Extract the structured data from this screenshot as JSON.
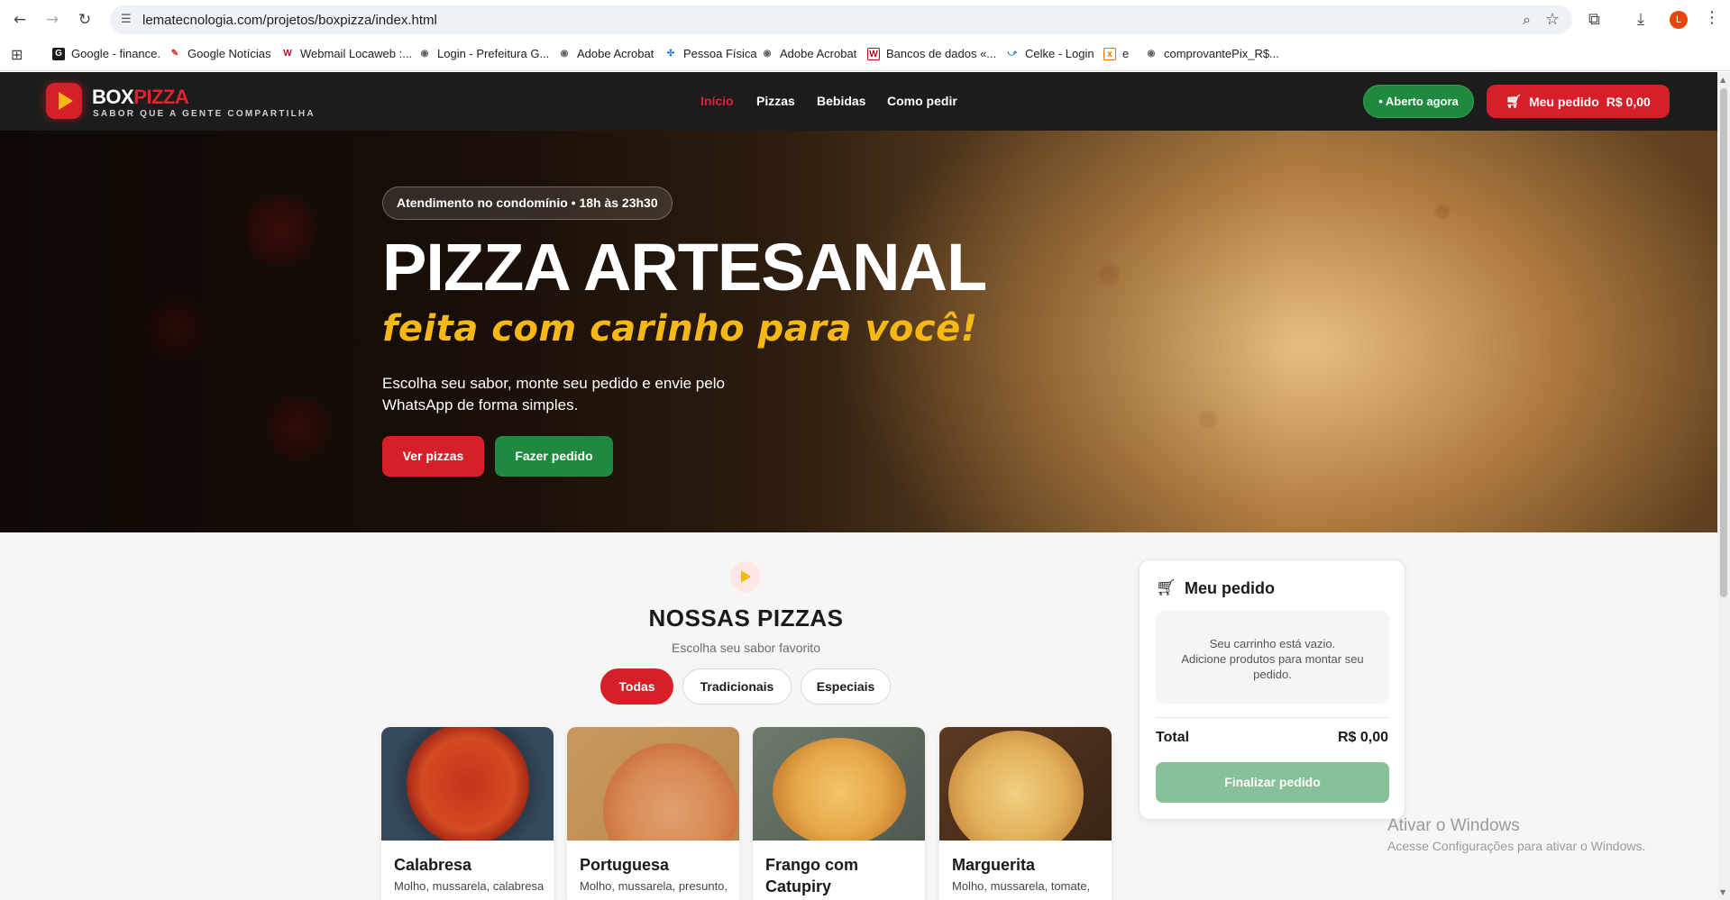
{
  "browser": {
    "url": "lematecnologia.com/projetos/boxpizza/index.html",
    "profile_initial": "L",
    "icons": {
      "back": "back-arrow-icon",
      "forward": "forward-arrow-icon",
      "reload": "reload-icon",
      "site_info": "site-info-icon",
      "zoom": "zoom-icon",
      "bookmark": "star-icon",
      "extensions": "puzzle-icon",
      "downloads": "download-icon",
      "menu": "kebab-menu-icon"
    }
  },
  "bookmarks": [
    {
      "label": "Google - finance.",
      "fav_color": "#1a1a1a"
    },
    {
      "label": "Google Notícias",
      "fav_color": "#d93025"
    },
    {
      "label": "Webmail Locaweb :...",
      "fav_color": "#c4001d"
    },
    {
      "label": "Login - Prefeitura G...",
      "fav_color": "#5f6368"
    },
    {
      "label": "Adobe Acrobat",
      "fav_color": "#5f6368"
    },
    {
      "label": "Pessoa Física",
      "fav_color": "#1a73e8"
    },
    {
      "label": "Adobe Acrobat",
      "fav_color": "#5f6368"
    },
    {
      "label": "Bancos de dados «...",
      "fav_color": "#c4001d"
    },
    {
      "label": "Celke - Login",
      "fav_color": "#1a73e8"
    },
    {
      "label": "e",
      "fav_color": "#e8710a"
    },
    {
      "label": "comprovantePix_R$...",
      "fav_color": "#5f6368"
    }
  ],
  "header": {
    "brand_white": "BOX",
    "brand_red": "PIZZA",
    "tagline": "SABOR QUE A GENTE COMPARTILHA",
    "nav": [
      "Início",
      "Pizzas",
      "Bebidas",
      "Como pedir"
    ],
    "open_label": "• Aberto agora",
    "order_label": "Meu pedido",
    "order_total": "R$ 0,00"
  },
  "hero": {
    "badge": "Atendimento no condomínio • 18h às 23h30",
    "title": "PIZZA ARTESANAL",
    "subtitle": "feita com carinho para você!",
    "text": "Escolha seu sabor, monte seu pedido e envie pelo WhatsApp de forma simples.",
    "btn_pizzas": "Ver pizzas",
    "btn_order": "Fazer pedido"
  },
  "menu": {
    "title": "NOSSAS PIZZAS",
    "subtitle": "Escolha seu sabor favorito",
    "filters": [
      "Todas",
      "Tradicionais",
      "Especiais"
    ],
    "items": [
      {
        "name": "Calabresa",
        "desc": "Molho, mussarela, calabresa"
      },
      {
        "name": "Portuguesa",
        "desc": "Molho, mussarela, presunto,"
      },
      {
        "name": "Frango com Catupiry",
        "desc": ""
      },
      {
        "name": "Marguerita",
        "desc": "Molho, mussarela, tomate,"
      }
    ]
  },
  "cart": {
    "title": "Meu pedido",
    "empty_line1": "Seu carrinho está vazio.",
    "empty_line2": "Adicione produtos para montar seu pedido.",
    "total_label": "Total",
    "total_value": "R$ 0,00",
    "finish_label": "Finalizar pedido"
  },
  "os_watermark": {
    "line1": "Ativar o Windows",
    "line2": "Acesse Configurações para ativar o Windows."
  },
  "colors": {
    "brand_red": "#d71f2a",
    "accent_yellow": "#f5b817",
    "open_green": "#1f8a3f",
    "header_bg": "#1c1c1c"
  }
}
